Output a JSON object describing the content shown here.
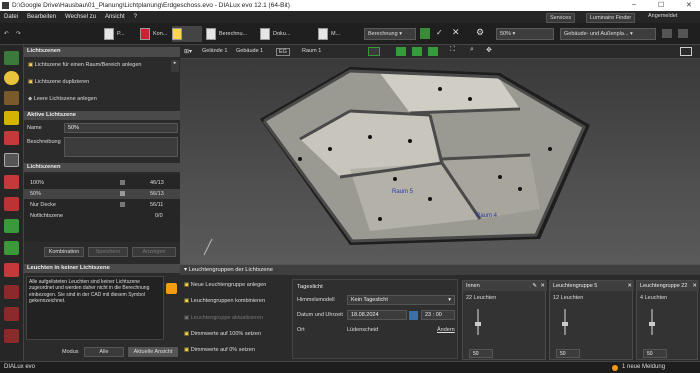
{
  "window": {
    "title": "D:\\Google Drive\\Hausbau\\01_Planung\\Lichtplanung\\Erdgeschoss.evo - DIALux evo 12.1  (64-Bit)",
    "min": "–",
    "max": "☐",
    "close": "✕"
  },
  "menu": [
    "Datei",
    "Bearbeiten",
    "Wechsel zu",
    "Ansicht",
    "?"
  ],
  "menu_right": {
    "services": "Services",
    "luminaire": "Luminaire Finder",
    "user": "Angemeldet"
  },
  "toolbar": {
    "items": [
      "P...",
      "Kon...",
      "",
      "Berechnu...",
      "Doku...",
      "M..."
    ],
    "calc": "Berechnung",
    "zoom": "50%",
    "view_mode": "Gebäude- und Außenpla..."
  },
  "view_toolbar": {
    "gelaende": "Gelände 1",
    "gebaeude": "Gebäude 1",
    "eg": "EG",
    "raum": "Raum 1"
  },
  "left": {
    "lichtszenen_title": "Lichtszenen",
    "actions": [
      "Lichtszene für einen Raum/Bereich anlegen",
      "Lichtszene duplizieren",
      "Leere Lichtszene anlegen"
    ],
    "aktive_title": "Aktive Lichtszene",
    "name_label": "Name",
    "name_value": "50%",
    "beschreibung_label": "Beschreibung",
    "szenen_title": "Lichtszenen",
    "szenen": [
      {
        "name": "100%",
        "count": "46/13"
      },
      {
        "name": "50%",
        "count": "56/13"
      },
      {
        "name": "Nur Decke",
        "count": "56/11"
      },
      {
        "name": "Notlichtszene",
        "count": "0/0"
      }
    ],
    "kombination": "Kombination",
    "speichern": "Speichern",
    "anzeigen": "Anzeigen",
    "keine_title": "Leuchten in keiner Lichtszene",
    "keine_text": "Alle aufgelisteten Leuchten sind keiner Lichtszene zugeordnet und werden daher nicht in die Berechnung einbezogen. Sie sind in der CAD mit diesem Symbol gekennzeichnet.",
    "modus": "Modus",
    "alle": "Alle",
    "aktuelle": "Aktuelle Ansicht"
  },
  "view": {
    "rooms": [
      "Raum 5",
      "Raum 4"
    ]
  },
  "bottom": {
    "title": "Leuchtengruppen der Lichtszene",
    "actions": [
      "Neue Leuchtengruppe anlegen",
      "Leuchtengruppen kombinieren",
      "Leuchtengruppe aktualisieren",
      "Dimmwerte auf 100% setzen",
      "Dimmwerte auf 0% setzen"
    ],
    "tageslicht": "Tageslicht",
    "himmel_label": "Himmelsmodell",
    "himmel_value": "Kein Tageslicht",
    "datum_label": "Datum und Uhrzeit",
    "datum_value": "18.08.2024",
    "uhr_h": "23",
    "uhr_m": "00",
    "ort_label": "Ort",
    "ort_value": "Lüdenscheid",
    "aendern": "Ändern",
    "groups": [
      {
        "name": "Innen",
        "count": "22 Leuchten",
        "value": "50"
      },
      {
        "name": "Leuchtengruppe 5",
        "count": "12 Leuchten",
        "value": "50"
      },
      {
        "name": "Leuchtengruppe 22",
        "count": "4 Leuchten",
        "value": "50"
      }
    ]
  },
  "status": {
    "logo": "DIALux evo",
    "meldung": "1 neue Meldung"
  },
  "colors": {
    "accent_red": "#c0392b",
    "accent_green": "#3a9a3a",
    "warn_orange": "#f39c12"
  }
}
